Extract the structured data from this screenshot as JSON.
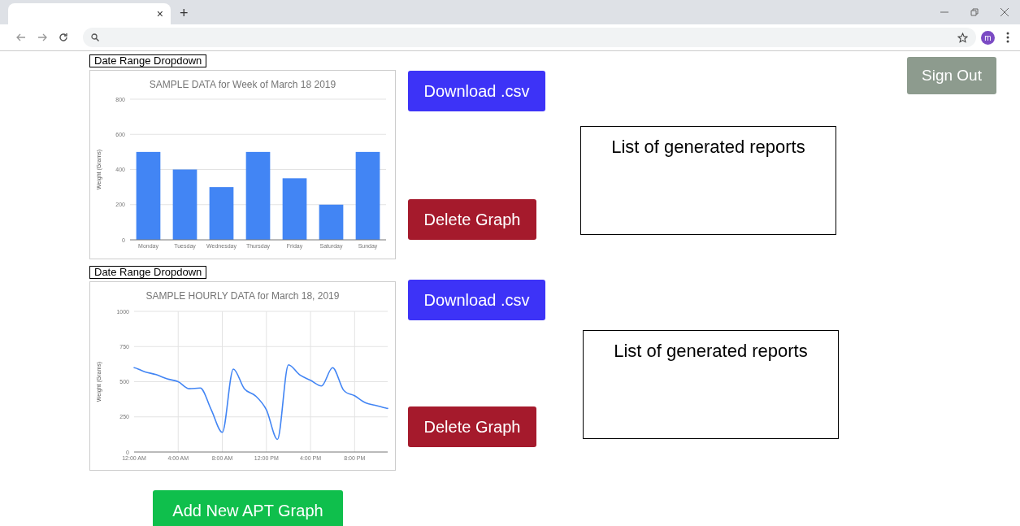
{
  "browser": {
    "tab_close": "×",
    "new_tab": "+",
    "avatar": "m"
  },
  "sign_out": "Sign Out",
  "sections": [
    {
      "dropdown": "Date Range Dropdown",
      "download": "Download .csv",
      "delete": "Delete Graph",
      "reports": "List of generated reports",
      "chart_data": {
        "type": "bar",
        "title": "SAMPLE DATA for Week of March 18 2019",
        "ylabel": "Weight (Grams)",
        "categories": [
          "Monday",
          "Tuesday",
          "Wednesday",
          "Thursday",
          "Friday",
          "Saturday",
          "Sunday"
        ],
        "series": [
          {
            "color": "#4285f4",
            "values": [
              500,
              400,
              300,
              500,
              350,
              200,
              500
            ]
          }
        ],
        "grid": true,
        "ylim": [
          0,
          800
        ],
        "yticks": [
          0,
          200,
          400,
          600,
          800
        ]
      }
    },
    {
      "dropdown": "Date Range Dropdown",
      "download": "Download .csv",
      "delete": "Delete Graph",
      "reports": "List of generated reports",
      "chart_data": {
        "type": "line",
        "title": "SAMPLE HOURLY DATA for March 18, 2019",
        "ylabel": "Weight (Grams)",
        "x": [
          0,
          1,
          2,
          3,
          4,
          5,
          6,
          7,
          8,
          9,
          10,
          11,
          12,
          13,
          14,
          15,
          16,
          17,
          18,
          19,
          20,
          21,
          22,
          23
        ],
        "grid": true,
        "series": [
          {
            "color": "#4285f4",
            "values": [
              600,
              570,
              550,
              520,
              500,
              450,
              455,
              300,
              140,
              590,
              450,
              400,
              300,
              90,
              620,
              550,
              510,
              470,
              600,
              440,
              400,
              350,
              330,
              310
            ]
          }
        ],
        "xlim": [
          0,
          23
        ],
        "ylim": [
          0,
          1000
        ],
        "xticks": [
          {
            "value": 0,
            "label": "12:00 AM"
          },
          {
            "value": 4,
            "label": "4:00 AM"
          },
          {
            "value": 8,
            "label": "8:00 AM"
          },
          {
            "value": 12,
            "label": "12:00 PM"
          },
          {
            "value": 16,
            "label": "4:00 PM"
          },
          {
            "value": 20,
            "label": "8:00 PM"
          }
        ],
        "yticks": [
          0,
          250,
          500,
          750,
          1000
        ]
      }
    }
  ],
  "add_graph": "Add New APT Graph"
}
